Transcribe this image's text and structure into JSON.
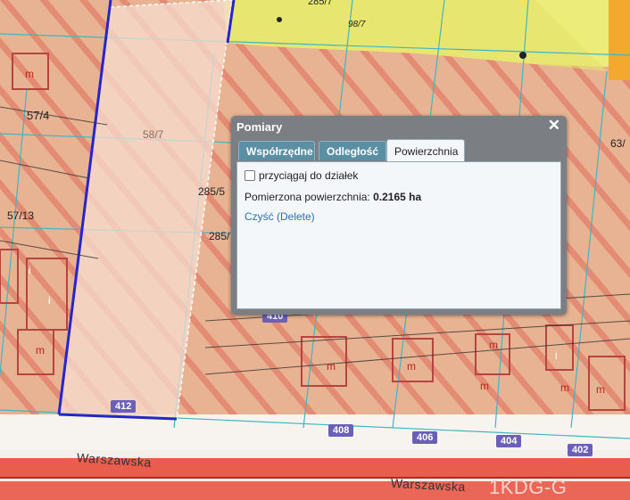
{
  "map": {
    "plot_labels": [
      "58/7",
      "57/4",
      "57/13",
      "285/5",
      "285/",
      "63/",
      "285/7",
      "98/7"
    ],
    "symbols": [
      "m",
      "m",
      "i",
      "i",
      "m",
      "m",
      "m",
      "m",
      "m",
      "m",
      "i"
    ],
    "road_badges": [
      "412",
      "408",
      "406",
      "404",
      "402",
      "410"
    ],
    "street_names": [
      "Warszawska",
      "Warszawska"
    ],
    "road_code": "1KDG-G"
  },
  "dialog": {
    "title": "Pomiary",
    "close_symbol": "✕",
    "tabs": [
      {
        "label": "Współrzędne"
      },
      {
        "label": "Odległość"
      },
      {
        "label": "Powierzchnia"
      }
    ],
    "snap_checkbox_label": "przyciągaj do działek",
    "area_label": "Pomierzona powierzchnia:",
    "area_value": "0.2165 ha",
    "clear_link": "Czyść (Delete)"
  }
}
